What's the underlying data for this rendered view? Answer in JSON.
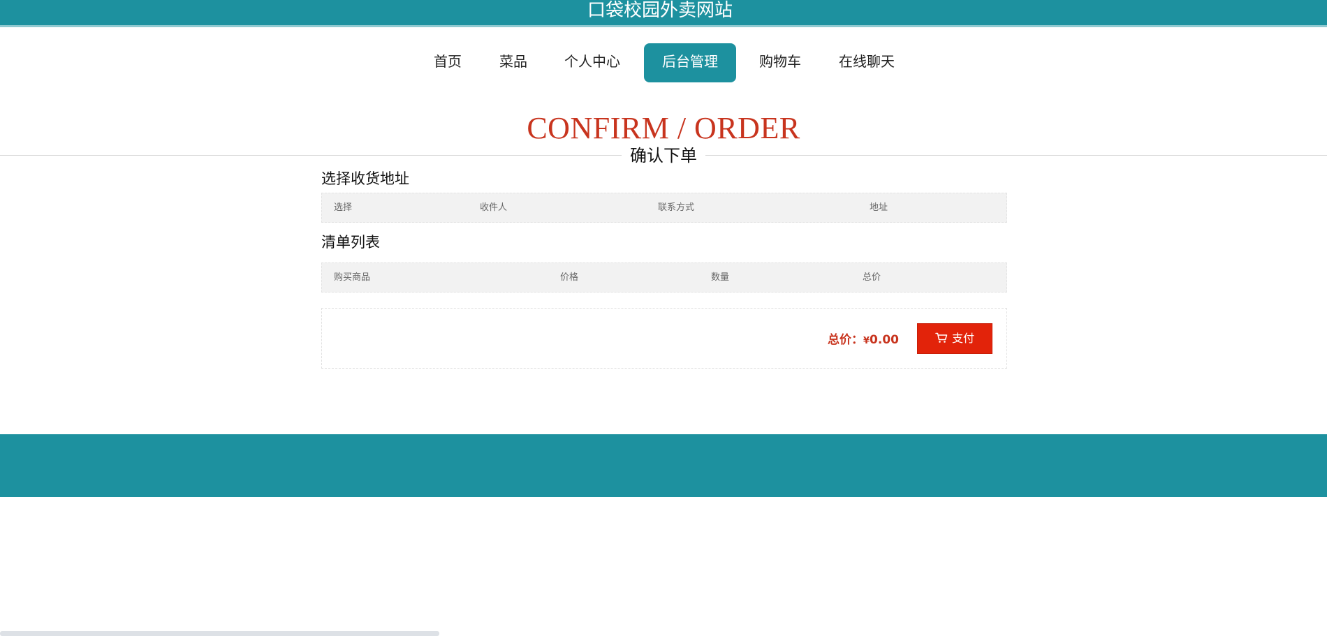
{
  "site": {
    "title": "口袋校园外卖网站"
  },
  "nav": {
    "items": [
      {
        "label": "首页"
      },
      {
        "label": "菜品"
      },
      {
        "label": "个人中心"
      },
      {
        "label": "后台管理"
      },
      {
        "label": "购物车"
      },
      {
        "label": "在线聊天"
      }
    ],
    "active_index": 3
  },
  "hero": {
    "title_en": "CONFIRM / ORDER",
    "title_cn": "确认下单"
  },
  "address_section": {
    "title": "选择收货地址",
    "columns": [
      "选择",
      "收件人",
      "联系方式",
      "地址"
    ]
  },
  "order_section": {
    "title": "清单列表",
    "columns": [
      "购买商品",
      "价格",
      "数量",
      "总价"
    ]
  },
  "summary": {
    "total_label": "总价：",
    "currency": "¥",
    "total_value": "0.00",
    "pay_label": "支付"
  },
  "colors": {
    "brand": "#1d919f",
    "accent_red": "#c8341e",
    "button_red": "#e2230a"
  },
  "icons": {
    "pay": "cart-icon"
  }
}
